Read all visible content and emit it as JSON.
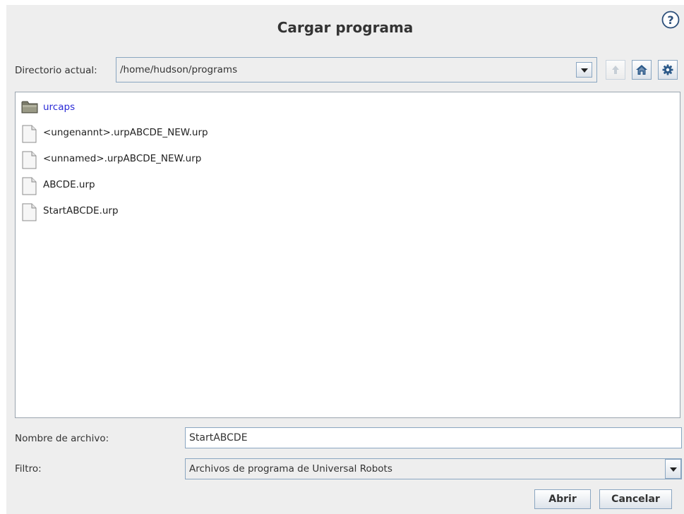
{
  "dialog": {
    "title": "Cargar programa",
    "help_icon": "question-circle-icon"
  },
  "directory": {
    "label": "Directorio actual:",
    "path": "/home/hudson/programs",
    "buttons": {
      "up_icon": "arrow-up-icon",
      "up_enabled": false,
      "home_icon": "home-icon",
      "settings_icon": "gear-icon"
    }
  },
  "files": [
    {
      "name": "urcaps",
      "type": "folder",
      "icon": "folder-icon"
    },
    {
      "name": "<ungenannt>.urpABCDE_NEW.urp",
      "type": "file",
      "icon": "file-icon"
    },
    {
      "name": "<unnamed>.urpABCDE_NEW.urp",
      "type": "file",
      "icon": "file-icon"
    },
    {
      "name": "ABCDE.urp",
      "type": "file",
      "icon": "file-icon"
    },
    {
      "name": "StartABCDE.urp",
      "type": "file",
      "icon": "file-icon"
    }
  ],
  "filename": {
    "label": "Nombre de archivo:",
    "value": "StartABCDE"
  },
  "filter": {
    "label": "Filtro:",
    "value": "Archivos de programa de Universal Robots"
  },
  "actions": {
    "open": "Abrir",
    "cancel": "Cancelar"
  },
  "colors": {
    "background": "#eeeeee",
    "border": "#8aa6c1",
    "folder_text": "#2a2ad6",
    "icon_blue": "#2c5a8a"
  }
}
